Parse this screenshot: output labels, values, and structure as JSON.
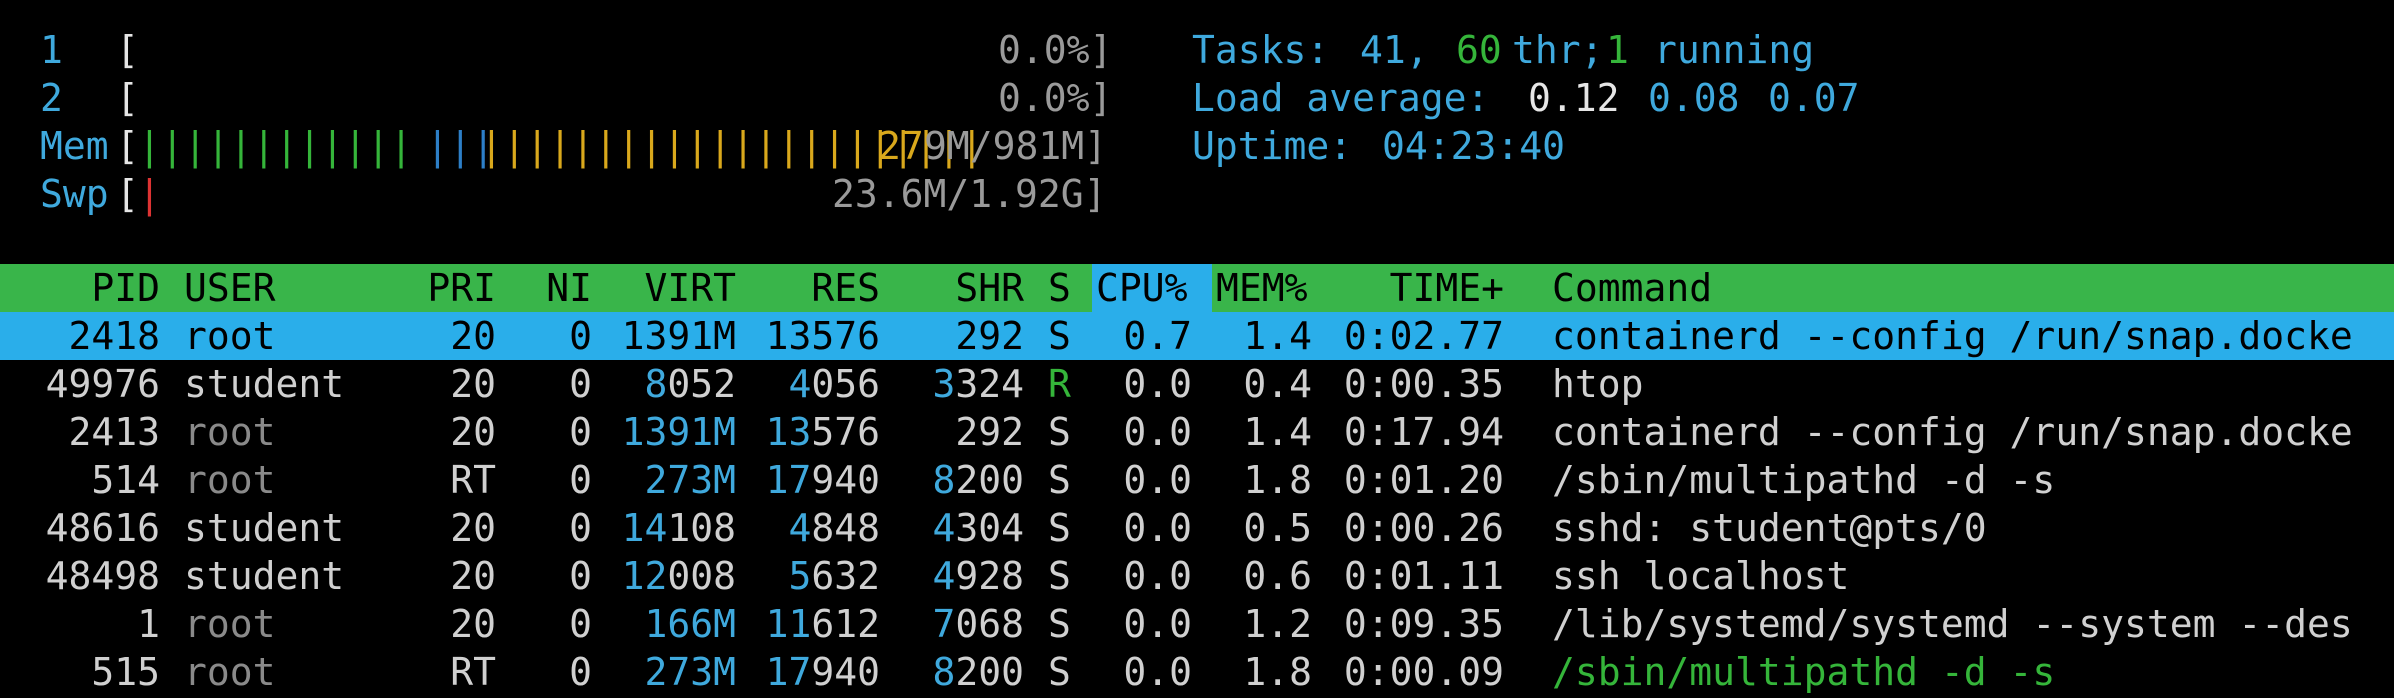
{
  "meters": {
    "cpu1": {
      "label": "1",
      "open": "[",
      "value": "0.0%]",
      "percent": 0.0
    },
    "cpu2": {
      "label": "2",
      "open": "[",
      "value": "0.0%]",
      "percent": 0.0
    },
    "mem": {
      "label": "Mem",
      "open": "[",
      "bars_green": "||||||||||||",
      "bars_blue": "|||",
      "bars_yellow": "||||||||||||||||||||||",
      "value_hl": "27",
      "value": "9M/981M]",
      "used": "279M",
      "total": "981M"
    },
    "swp": {
      "label": "Swp",
      "open": "[",
      "bar_red": "|",
      "value": "23.6M/1.92G]",
      "used": "23.6M",
      "total": "1.92G"
    }
  },
  "tasks": {
    "label": "Tasks:",
    "count": "41,",
    "threads": "60",
    "thr_label": "thr;",
    "running": "1",
    "running_label": "running"
  },
  "load": {
    "label": "Load average:",
    "one": "0.12",
    "five": "0.08",
    "fifteen": "0.07"
  },
  "uptime": {
    "label": "Uptime:",
    "value": "04:23:40"
  },
  "columns": [
    "PID",
    "USER",
    "PRI",
    "NI",
    "VIRT",
    "RES",
    "SHR",
    "S",
    "CPU%",
    "MEM%",
    "TIME+",
    "Command"
  ],
  "processes": [
    {
      "pid": "2418",
      "user": "root",
      "pri": "20",
      "ni": "0",
      "virt": "1391M",
      "res": "13576",
      "shr": "292",
      "s": "S",
      "cpu": "0.7",
      "mem": "1.4",
      "time": "0:02.77",
      "cmd": "containerd --config /run/snap.docke"
    },
    {
      "pid": "49976",
      "user": "student",
      "pri": "20",
      "ni": "0",
      "virt": "8052",
      "res": "4056",
      "shr": "3324",
      "s": "R",
      "cpu": "0.0",
      "mem": "0.4",
      "time": "0:00.35",
      "cmd": "htop"
    },
    {
      "pid": "2413",
      "user": "root",
      "pri": "20",
      "ni": "0",
      "virt": "1391M",
      "res": "13576",
      "shr": "292",
      "s": "S",
      "cpu": "0.0",
      "mem": "1.4",
      "time": "0:17.94",
      "cmd": "containerd --config /run/snap.docke"
    },
    {
      "pid": "514",
      "user": "root",
      "pri": "RT",
      "ni": "0",
      "virt": "273M",
      "res": "17940",
      "shr": "8200",
      "s": "S",
      "cpu": "0.0",
      "mem": "1.8",
      "time": "0:01.20",
      "cmd": "/sbin/multipathd -d -s"
    },
    {
      "pid": "48616",
      "user": "student",
      "pri": "20",
      "ni": "0",
      "virt": "14108",
      "res": "4848",
      "shr": "4304",
      "s": "S",
      "cpu": "0.0",
      "mem": "0.5",
      "time": "0:00.26",
      "cmd": "sshd: student@pts/0"
    },
    {
      "pid": "48498",
      "user": "student",
      "pri": "20",
      "ni": "0",
      "virt": "12008",
      "res": "5632",
      "shr": "4928",
      "s": "S",
      "cpu": "0.0",
      "mem": "0.6",
      "time": "0:01.11",
      "cmd": "ssh localhost"
    },
    {
      "pid": "1",
      "user": "root",
      "pri": "20",
      "ni": "0",
      "virt": "166M",
      "res": "11612",
      "shr": "7068",
      "s": "S",
      "cpu": "0.0",
      "mem": "1.2",
      "time": "0:09.35",
      "cmd": "/lib/systemd/systemd --system --des"
    },
    {
      "pid": "515",
      "user": "root",
      "pri": "RT",
      "ni": "0",
      "virt": "273M",
      "res": "17940",
      "shr": "8200",
      "s": "S",
      "cpu": "0.0",
      "mem": "1.8",
      "time": "0:00.09",
      "cmd": "/sbin/multipathd -d -s"
    }
  ]
}
